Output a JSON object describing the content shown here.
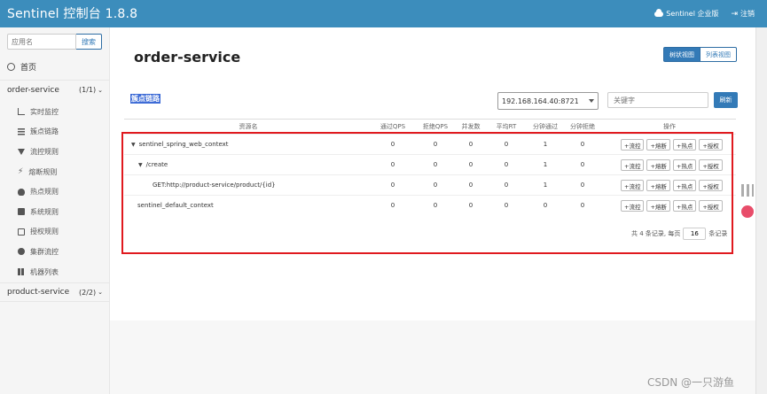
{
  "app": {
    "title": "Sentinel 控制台 1.8.8",
    "enterprise_label": "Sentinel 企业版",
    "logout_label": "注销",
    "accent": "#3c8dbc"
  },
  "sidebar": {
    "search_placeholder": "应用名",
    "search_button": "搜索",
    "home_label": "首页",
    "apps": [
      {
        "name": "order-service",
        "count": "(1/1)"
      },
      {
        "name": "product-service",
        "count": "(2/2)"
      }
    ],
    "items": [
      {
        "label": "实时监控",
        "icon": "bar-chart-icon"
      },
      {
        "label": "簇点链路",
        "icon": "list-icon"
      },
      {
        "label": "流控规则",
        "icon": "filter-icon"
      },
      {
        "label": "熔断规则",
        "icon": "bolt-icon"
      },
      {
        "label": "热点规则",
        "icon": "flame-icon"
      },
      {
        "label": "系统规则",
        "icon": "lock-icon"
      },
      {
        "label": "授权规则",
        "icon": "check-icon"
      },
      {
        "label": "集群流控",
        "icon": "globe-icon"
      },
      {
        "label": "机器列表",
        "icon": "grid-icon"
      }
    ]
  },
  "main": {
    "title": "order-service",
    "view_tree": "树状视图",
    "view_list": "列表视图",
    "section_label": "簇点链路",
    "machine": "192.168.164.40:8721",
    "keyword_placeholder": "关键字",
    "refresh": "刷新",
    "columns": [
      "资源名",
      "通过QPS",
      "拒绝QPS",
      "并发数",
      "平均RT",
      "分钟通过",
      "分钟拒绝",
      "操作"
    ],
    "rows": [
      {
        "name": "sentinel_spring_web_context",
        "expander": "▼",
        "values": [
          "0",
          "0",
          "0",
          "0",
          "1",
          "0"
        ]
      },
      {
        "name": "/create",
        "expander": "▼",
        "values": [
          "0",
          "0",
          "0",
          "0",
          "1",
          "0"
        ]
      },
      {
        "name": "GET:http://product-service/product/{id}",
        "expander": "",
        "values": [
          "0",
          "0",
          "0",
          "0",
          "1",
          "0"
        ]
      },
      {
        "name": "sentinel_default_context",
        "expander": "",
        "values": [
          "0",
          "0",
          "0",
          "0",
          "0",
          "0"
        ]
      }
    ],
    "row_actions": [
      "+流控",
      "+熔断",
      "+热点",
      "+授权"
    ],
    "pager_prefix": "共 4 条记录, 每页",
    "page_size": "16",
    "pager_suffix": "条记录"
  },
  "watermark": "CSDN @一只游鱼"
}
